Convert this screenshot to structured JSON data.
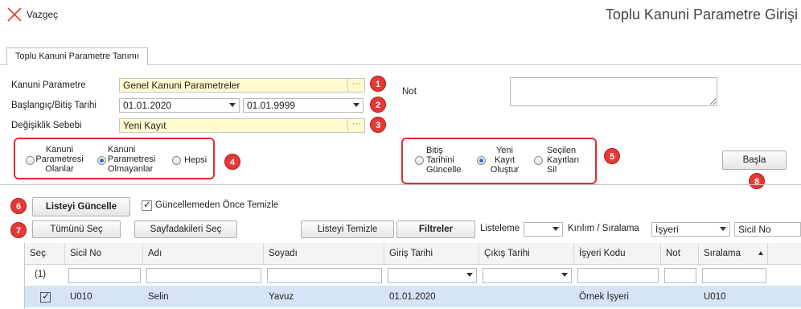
{
  "header": {
    "cancel_label": "Vazgeç",
    "title": "Toplu Kanuni Parametre Girişi"
  },
  "tab": {
    "label": "Toplu Kanuni Parametre Tanımı"
  },
  "form": {
    "kanuni_parametre_label": "Kanuni Parametre",
    "kanuni_parametre_value": "Genel Kanuni Parametreler",
    "tarih_label": "Başlangıç/Bitiş Tarihi",
    "baslangic_value": "01.01.2020",
    "bitis_value": "01.01.9999",
    "degisiklik_label": "Değişiklik Sebebi",
    "degisiklik_value": "Yeni Kayıt",
    "not_label": "Not",
    "lookup_glyph": "···"
  },
  "badges": [
    "1",
    "2",
    "3",
    "4",
    "5",
    "6",
    "7",
    "8"
  ],
  "radio_group_1": {
    "options": [
      {
        "line1": "Kanuni",
        "line2": "Parametresi",
        "line3": "Olanlar",
        "checked": false
      },
      {
        "line1": "Kanuni",
        "line2": "Parametresi",
        "line3": "Olmayanlar",
        "checked": true
      },
      {
        "line1": "Hepsi",
        "checked": false
      }
    ]
  },
  "radio_group_2": {
    "options": [
      {
        "line1": "Bitiş",
        "line2": "Tarihini",
        "line3": "Güncelle",
        "checked": false
      },
      {
        "line1": "Yeni",
        "line2": "Kayıt",
        "line3": "Oluştur",
        "checked": true
      },
      {
        "line1": "Seçilen",
        "line2": "Kayıtları",
        "line3": "Sil",
        "checked": false
      }
    ]
  },
  "buttons": {
    "basla": "Başla",
    "listeyi_guncelle": "Listeyi Güncelle",
    "tumunu_sec": "Tümünü Seç",
    "sayfadakileri_sec": "Sayfadakileri Seç",
    "listeyi_temizle": "Listeyi Temizle",
    "filtreler": "Filtreler"
  },
  "toolbar": {
    "guncellemeden_label": "Güncellemeden Önce Temizle",
    "guncellemeden_checked": true,
    "listeleme_label": "Listeleme",
    "listeleme_value": "",
    "kirilim_label": "Kırılım / Sıralama",
    "kirilim_value": "İşyeri",
    "sicil_value": "Sicil No"
  },
  "grid": {
    "columns": [
      "Seç",
      "Sicil No",
      "Adı",
      "Soyadı",
      "Giriş Tarihi",
      "Çıkış Tarihi",
      "İşyeri Kodu",
      "Not",
      "Sıralama"
    ],
    "filter_count": "(1)",
    "rows": [
      {
        "selected": true,
        "sicil_no": "U010",
        "adi": "Selin",
        "soyadi": "Yavuz",
        "giris": "01.01.2020",
        "cikis": "",
        "isyeri": "Örnek İşyeri",
        "not": "",
        "siralama": "U010"
      }
    ]
  }
}
